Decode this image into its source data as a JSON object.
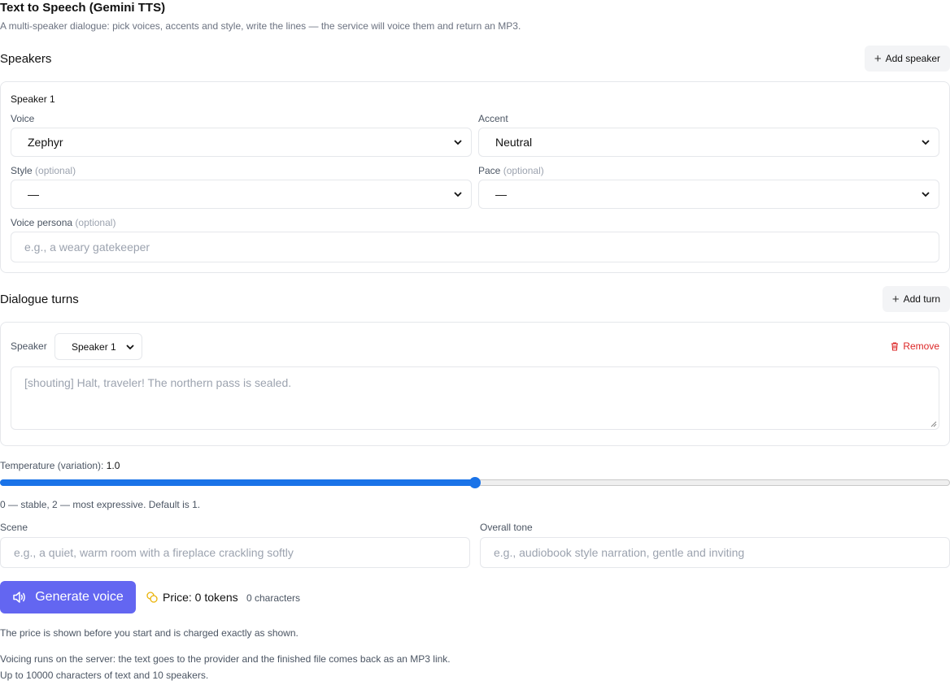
{
  "header": {
    "title": "Text to Speech (Gemini TTS)",
    "subtitle": "A multi-speaker dialogue: pick voices, accents and style, write the lines — the service will voice them and return an MP3."
  },
  "speakers": {
    "title": "Speakers",
    "add_label": "Add speaker",
    "items": [
      {
        "name": "Speaker 1",
        "voice_label": "Voice",
        "voice_value": "Zephyr",
        "accent_label": "Accent",
        "accent_value": "Neutral",
        "style_label": "Style",
        "style_value": "—",
        "pace_label": "Pace",
        "pace_value": "—",
        "persona_label": "Voice persona",
        "persona_placeholder": "e.g., a weary gatekeeper"
      }
    ],
    "optional_text": "(optional)"
  },
  "dialogue": {
    "title": "Dialogue turns",
    "add_label": "Add turn",
    "turns": [
      {
        "speaker_label": "Speaker",
        "speaker_value": "Speaker 1",
        "remove_label": "Remove",
        "text_placeholder": "[shouting] Halt, traveler! The northern pass is sealed."
      }
    ]
  },
  "temperature": {
    "label": "Temperature (variation):",
    "value_text": "1.0",
    "value": 1.0,
    "min": 0,
    "max": 2,
    "hint": "0 — stable, 2 — most expressive. Default is 1."
  },
  "scene": {
    "label": "Scene",
    "placeholder": "e.g., a quiet, warm room with a fireplace crackling softly"
  },
  "tone": {
    "label": "Overall tone",
    "placeholder": "e.g., audiobook style narration, gentle and inviting"
  },
  "actions": {
    "generate_label": "Generate voice",
    "price_text": "Price: 0 tokens",
    "chars_text": "0 characters"
  },
  "notes": {
    "price_note": "The price is shown before you start and is charged exactly as shown.",
    "server_note": "Voicing runs on the server: the text goes to the provider and the finished file comes back as an MP3 link.",
    "limits_note": "Up to 10000 characters of text and 10 speakers."
  },
  "colors": {
    "primary": "#6366f1",
    "slider": "#1a73e8",
    "danger": "#dc2626",
    "coin": "#eab308"
  }
}
